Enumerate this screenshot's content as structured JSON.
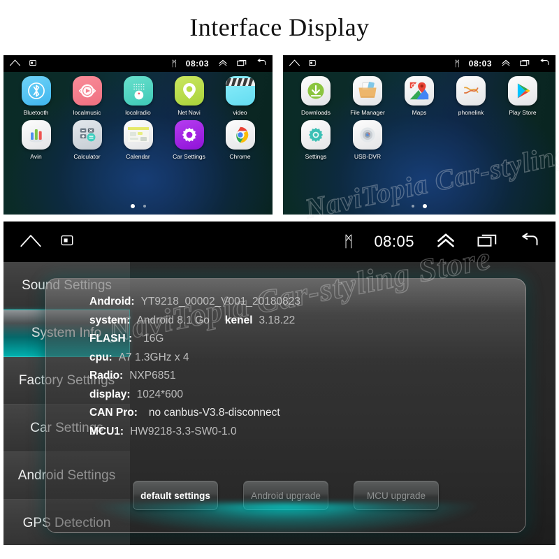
{
  "title": "Interface Display",
  "watermark": "NaviTopia Car-styling Store",
  "screens": [
    {
      "name": "home-page-1",
      "statusbar": {
        "home_icon": "home-icon",
        "screenshot_icon": "screenshot-icon",
        "bluetooth_icon": "bluetooth-icon",
        "bluetooth_glyph": "ᛗ",
        "time": "08:03",
        "expand_icon": "chevron-up-icon",
        "recents_icon": "recents-icon",
        "back_icon": "back-icon"
      },
      "apps": [
        {
          "label": "Bluetooth",
          "icon": "bluetooth-app-icon",
          "color": "#5BC8F5"
        },
        {
          "label": "localmusic",
          "icon": "localmusic-app-icon",
          "color": "#F47F8D"
        },
        {
          "label": "localradio",
          "icon": "localradio-app-icon",
          "color": "#52D6C4"
        },
        {
          "label": "Net Navi",
          "icon": "netnavi-app-icon",
          "color": "#BBDD4C"
        },
        {
          "label": "video",
          "icon": "video-app-icon",
          "color": "#77E6F5"
        },
        {
          "label": "Avin",
          "icon": "avin-app-icon",
          "color": "#EDEDED"
        },
        {
          "label": "Calculator",
          "icon": "calculator-app-icon",
          "color": "#D8DDE2"
        },
        {
          "label": "Calendar",
          "icon": "calendar-app-icon",
          "color": "#EFEFEF"
        },
        {
          "label": "Car Settings",
          "icon": "car-settings-app-icon",
          "color": "#A41CE0"
        },
        {
          "label": "Chrome",
          "icon": "chrome-app-icon",
          "color": "#F1F1F1"
        }
      ],
      "pager": {
        "count": 2,
        "active": 0
      }
    },
    {
      "name": "home-page-2",
      "statusbar": {
        "home_icon": "home-icon",
        "screenshot_icon": "screenshot-icon",
        "bluetooth_icon": "bluetooth-icon",
        "bluetooth_glyph": "ᛗ",
        "time": "08:03",
        "expand_icon": "chevron-up-icon",
        "recents_icon": "recents-icon",
        "back_icon": "back-icon"
      },
      "apps": [
        {
          "label": "Downloads",
          "icon": "downloads-app-icon",
          "color": "#8BC53F"
        },
        {
          "label": "File Manager",
          "icon": "file-manager-app-icon",
          "color": "#E8B96A"
        },
        {
          "label": "Maps",
          "icon": "maps-app-icon",
          "color": "#4285F4"
        },
        {
          "label": "phonelink",
          "icon": "phonelink-app-icon",
          "color": "#E8A33D"
        },
        {
          "label": "Play Store",
          "icon": "play-store-app-icon",
          "color": "#EAEAEA"
        },
        {
          "label": "Settings",
          "icon": "settings-app-icon",
          "color": "#3BBFB4"
        },
        {
          "label": "USB-DVR",
          "icon": "usb-dvr-app-icon",
          "color": "#C9CDD2"
        }
      ],
      "pager": {
        "count": 2,
        "active": 1
      }
    }
  ],
  "settings_screen": {
    "statusbar": {
      "home_icon": "home-icon",
      "screenshot_icon": "screenshot-icon",
      "bluetooth_glyph": "ᛗ",
      "time": "08:05",
      "expand_icon": "chevron-up-icon",
      "recents_icon": "recents-icon",
      "back_icon": "back-icon"
    },
    "sidebar": [
      {
        "label": "Sound Settings",
        "selected": false
      },
      {
        "label": "System Info",
        "selected": true
      },
      {
        "label": "Factory Settings",
        "selected": false
      },
      {
        "label": "Car Settings",
        "selected": false
      },
      {
        "label": "Android Settings",
        "selected": false
      },
      {
        "label": "GPS Detection",
        "selected": false
      }
    ],
    "info": [
      {
        "key": "Android:",
        "value": "YT9218_00002_V001_20180823"
      },
      {
        "key": "system:",
        "value": "Android 8.1 Go",
        "key2": "kenel",
        "value2": "3.18.22"
      },
      {
        "key": "FLASH :",
        "value": "16G"
      },
      {
        "key": "cpu:",
        "value": "A7 1.3GHz x 4"
      },
      {
        "key": "Radio:",
        "value": "NXP6851"
      },
      {
        "key": "display:",
        "value": "1024*600"
      },
      {
        "key": "CAN Pro:",
        "value": "no canbus-V3.8-disconnect",
        "bright": true
      },
      {
        "key": "MCU1:",
        "value": "HW9218-3.3-SW0-1.0"
      }
    ],
    "buttons": [
      {
        "label": "default settings",
        "primary": true
      },
      {
        "label": "Android upgrade",
        "primary": false
      },
      {
        "label": "MCU upgrade",
        "primary": false
      }
    ],
    "accent_color": "#00B0AE"
  }
}
